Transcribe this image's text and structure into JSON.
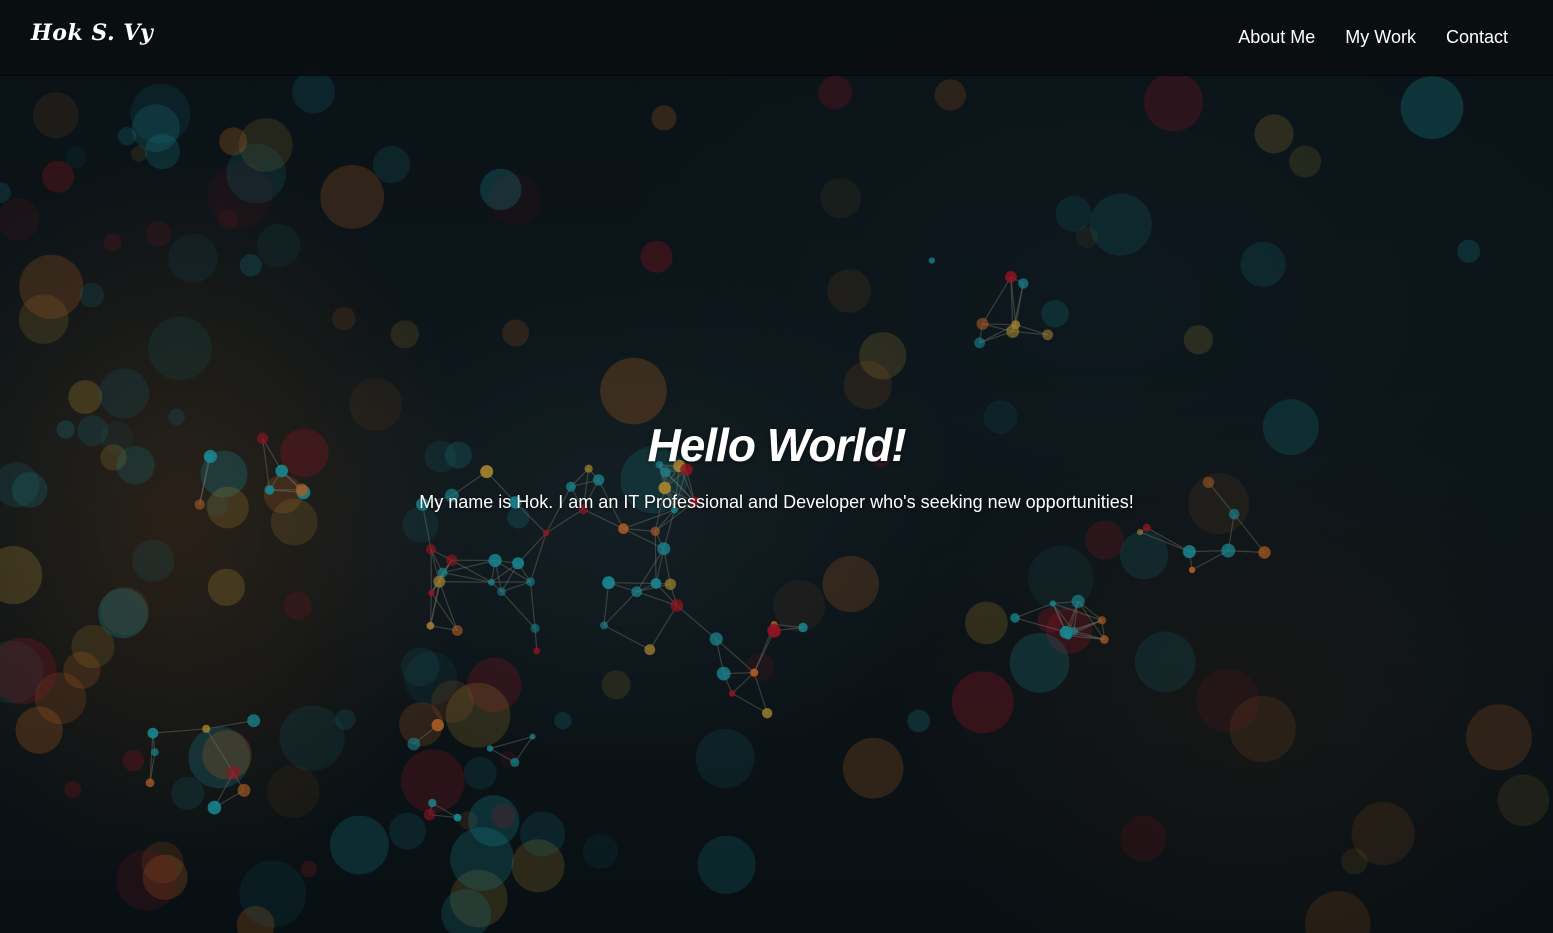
{
  "navbar": {
    "brand": "Hok S. Vy",
    "links": [
      {
        "label": "About Me"
      },
      {
        "label": "My Work"
      },
      {
        "label": "Contact"
      }
    ]
  },
  "hero": {
    "title": "Hello World!",
    "subtitle": "My name is Hok. I am an IT Professional and Developer who's seeking new opportunities!"
  },
  "colors": {
    "nav_background": "#0a0e10",
    "text": "#ffffff",
    "particle_teal": "#1fa3b0",
    "particle_gold": "#c9a03a",
    "particle_orange": "#d0702a",
    "particle_red": "#b5182a"
  }
}
